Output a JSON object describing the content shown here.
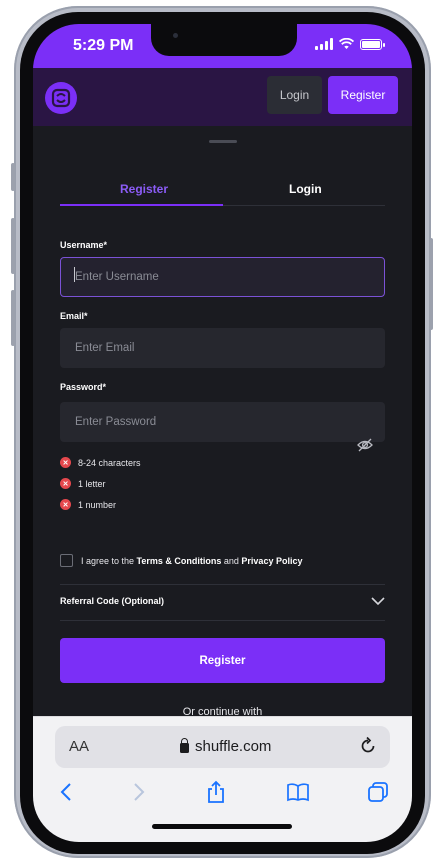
{
  "status_bar": {
    "time": "5:29 PM"
  },
  "header": {
    "login_label": "Login",
    "register_label": "Register"
  },
  "tabs": [
    {
      "label": "Register",
      "active": true
    },
    {
      "label": "Login",
      "active": false
    }
  ],
  "form": {
    "username_label": "Username*",
    "username_placeholder": "Enter Username",
    "email_label": "Email*",
    "email_placeholder": "Enter Email",
    "password_label": "Password*",
    "password_placeholder": "Enter Password",
    "rules": [
      "8-24 characters",
      "1 letter",
      "1 number"
    ],
    "agree_prefix": "I agree to the ",
    "agree_terms": "Terms & Conditions",
    "agree_and": " and ",
    "agree_privacy": "Privacy Policy",
    "referral_label": "Referral Code (Optional)",
    "submit_label": "Register",
    "continue_with": "Or continue with"
  },
  "browser": {
    "aa_label": "AA",
    "url": "shuffle.com"
  },
  "colors": {
    "accent": "#7b2ff7",
    "error": "#e5484d",
    "surface": "#1a1b20"
  }
}
